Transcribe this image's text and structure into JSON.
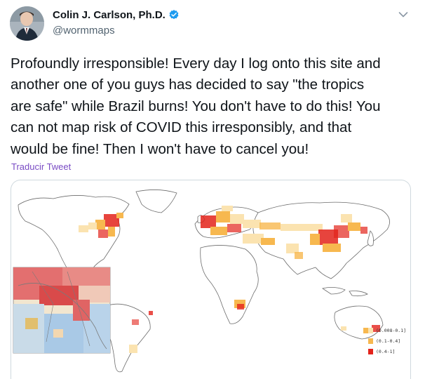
{
  "author": {
    "display_name": "Colin J. Carlson, Ph.D.",
    "handle": "@wormmaps",
    "verified": true
  },
  "tweet": {
    "text": "Profoundly irresponsible! Every day I log onto this site and\nanother one of you guys has decided to say \"the tropics\nare safe\" while Brazil burns! You don't have to do this! You\ncan not map risk of COVID this irresponsibly, and that\nwould be fine! Then I won't have to cancel you!",
    "translate_label": "Traducir Tweet"
  },
  "media": {
    "type": "world risk map",
    "legend": [
      {
        "label": "(0.008-0.1]",
        "color": "#fbe3b0"
      },
      {
        "label": "(0.1-0.4]",
        "color": "#f7b84f"
      },
      {
        "label": "(0.4-1]",
        "color": "#e3231b"
      }
    ]
  },
  "icons": {
    "verified": "verified-badge-icon",
    "more": "chevron-down-icon"
  },
  "colors": {
    "accent": "#1d9bf0",
    "translate_link": "#794bc4",
    "secondary_text": "#536471"
  }
}
